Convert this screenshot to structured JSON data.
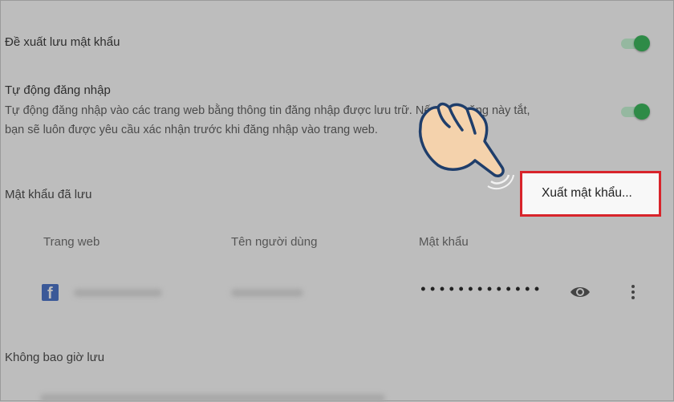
{
  "settings": {
    "offer_save": {
      "label": "Đề xuất lưu mật khẩu",
      "enabled": true
    },
    "auto_signin": {
      "label": "Tự động đăng nhập",
      "description_line1": "Tự động đăng nhập vào các trang web bằng thông tin đăng nhập được lưu trữ. Nếu tính năng này tắt,",
      "description_line2": "bạn sẽ luôn được yêu cầu xác nhận trước khi đăng nhập vào trang web.",
      "enabled": true
    }
  },
  "saved_passwords": {
    "heading": "Mật khẩu đã lưu",
    "columns": [
      "Trang web",
      "Tên người dùng",
      "Mật khẩu"
    ],
    "row": {
      "password_mask": "•••••••••••••"
    }
  },
  "menu": {
    "export_label": "Xuất mật khẩu..."
  },
  "never_saved": {
    "heading": "Không bao giờ lưu"
  },
  "icons": {
    "site": "facebook-icon",
    "show": "eye-icon",
    "more": "more-vert-icon",
    "pointer": "pointing-hand"
  },
  "colors": {
    "toggle_on": "#2e8b47",
    "highlight": "#d8242b"
  }
}
